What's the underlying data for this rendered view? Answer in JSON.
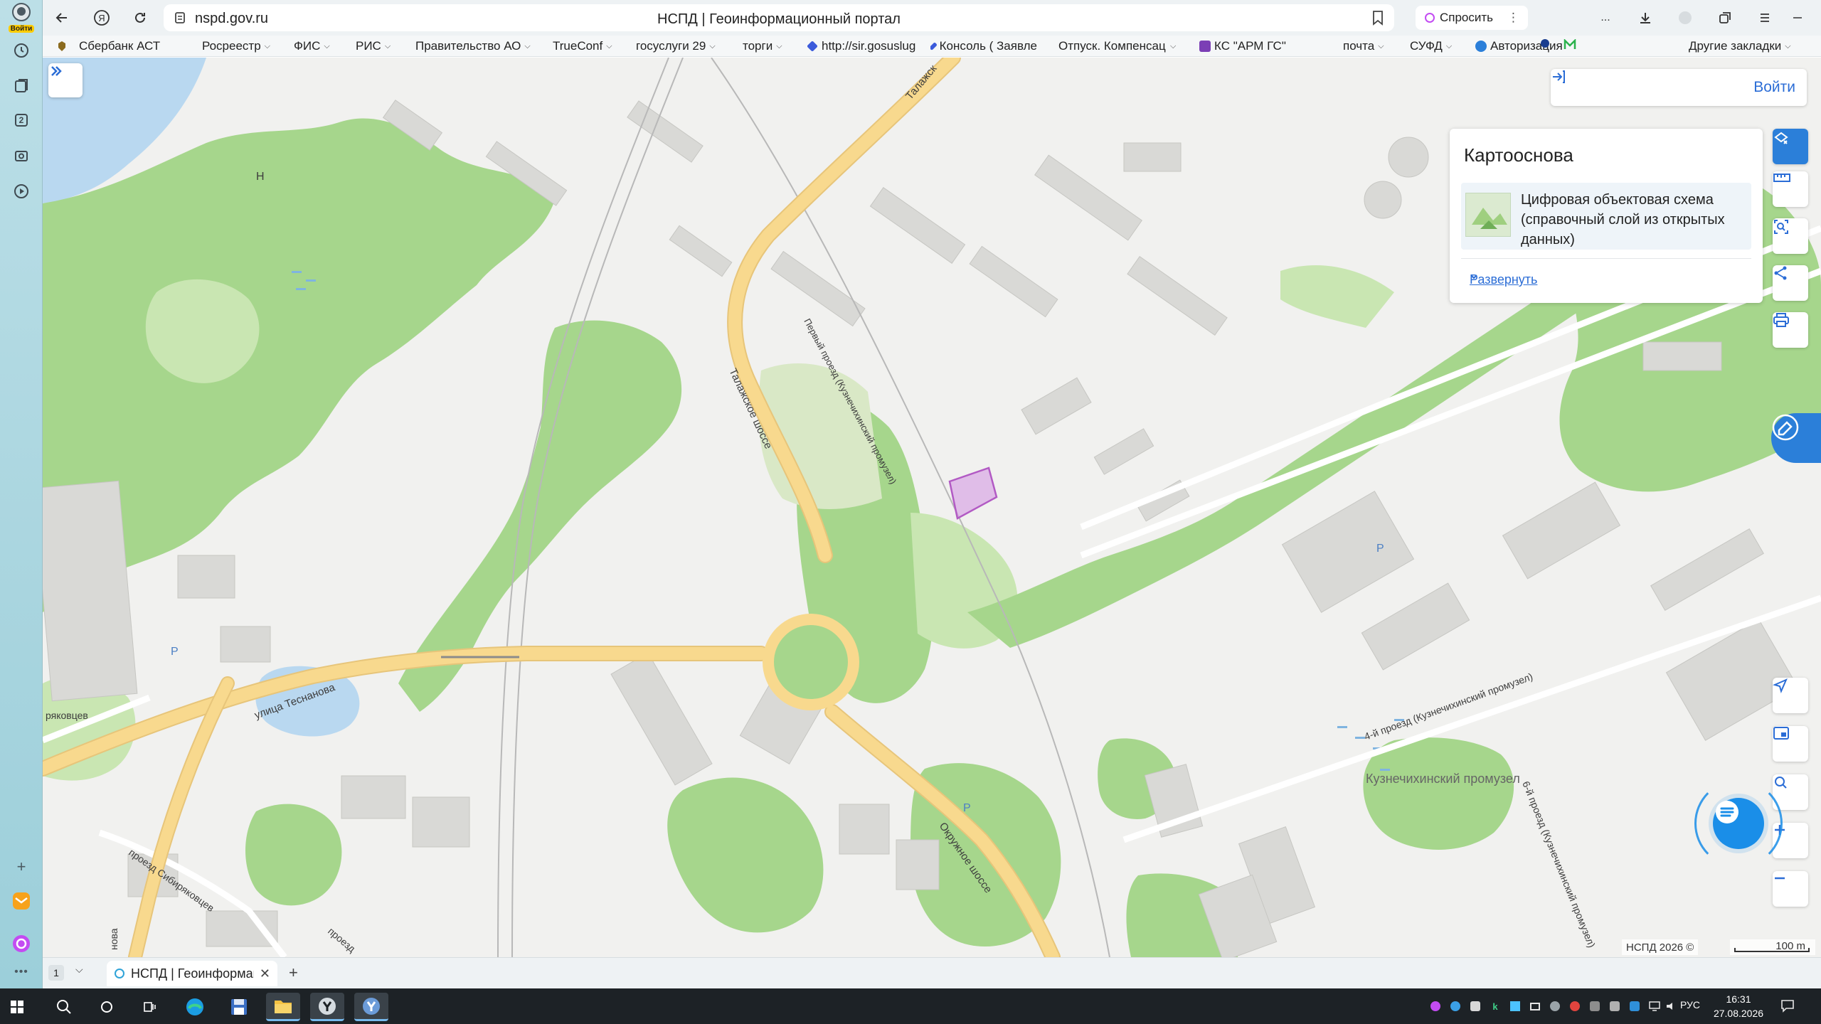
{
  "sidepanel": {
    "login_badge": "Войти",
    "items": [
      "history-icon",
      "collections-icon",
      "tabs-count-icon",
      "screenshot-icon",
      "media-icon"
    ],
    "tabs_number": "2"
  },
  "browser": {
    "url": "nspd.gov.ru",
    "title": "НСПД | Геоинформационный портал",
    "ask_label": "Спросить",
    "ellipsis": "..."
  },
  "bookmarks": [
    {
      "label": "Сбербанк АСТ",
      "folder": false,
      "color": "#1a9f29"
    },
    {
      "label": "Росреестр",
      "folder": true
    },
    {
      "label": "ФИС",
      "folder": true
    },
    {
      "label": "РИС",
      "folder": true
    },
    {
      "label": "Правительство АО",
      "folder": true
    },
    {
      "label": "TrueConf",
      "folder": true
    },
    {
      "label": "госуслуги 29",
      "folder": true
    },
    {
      "label": "торги",
      "folder": true
    },
    {
      "label": "http://sir.gosuslug",
      "folder": false,
      "color": "#3b5bdb"
    },
    {
      "label": "Консоль ( Заявле",
      "folder": false,
      "color": "#3b5bdb"
    },
    {
      "label": "Отпуск. Компенсац",
      "folder": true
    },
    {
      "label": "КС \"АРМ ГС\"",
      "folder": false,
      "color": "#7b3fb5"
    },
    {
      "label": "почта",
      "folder": true
    },
    {
      "label": "СУФД",
      "folder": true
    },
    {
      "label": "Авторизация",
      "folder": false,
      "color": "#2b7fd9"
    },
    {
      "label": "Другие закладки",
      "folder": true
    }
  ],
  "map": {
    "login_label": "Войти",
    "basemap_title": "Картооснова",
    "layer_name": "Цифровая объектовая схема (справочный слой из открытых данных)",
    "expand_label": "Развернуть",
    "attribution": "НСПД 2026 ©",
    "scale_label": "100 m",
    "labels": {
      "talagi_upper": "Талажск",
      "talagi": "Талажское шоссе",
      "first_passage": "Первый проезд (Кузнечихинский промузел)",
      "tesnanova": "улица Теснанова",
      "okruzhnoe": "Окружное шоссе",
      "fourth_passage": "4-й проезд (Кузнечихинский промузел)",
      "promzone": "Кузнечихинский промузел",
      "sixth_passage": "6-й проезд (Кузнечихинский промузел)",
      "sibiryakovtsev": "проезд Сибиряковцев",
      "sibiryakovtsev_left": "ряковцев",
      "proezd_bottom": "проезд",
      "vertical_bottom": "нова",
      "hospital": "H",
      "parking": "P"
    },
    "colors": {
      "background": "#f1f1ef",
      "green": "#a6d68c",
      "green_light": "#c9e6b2",
      "water": "#b9d8f0",
      "road_major": "#f8d98e",
      "building": "#d9d9d6",
      "highlight": "#b25ac4"
    }
  },
  "tabs": {
    "count": "1",
    "active_title": "НСПД | Геоинформаци"
  },
  "taskbar": {
    "lang": "РУС",
    "time": "16:31",
    "date": "27.08.2026"
  }
}
